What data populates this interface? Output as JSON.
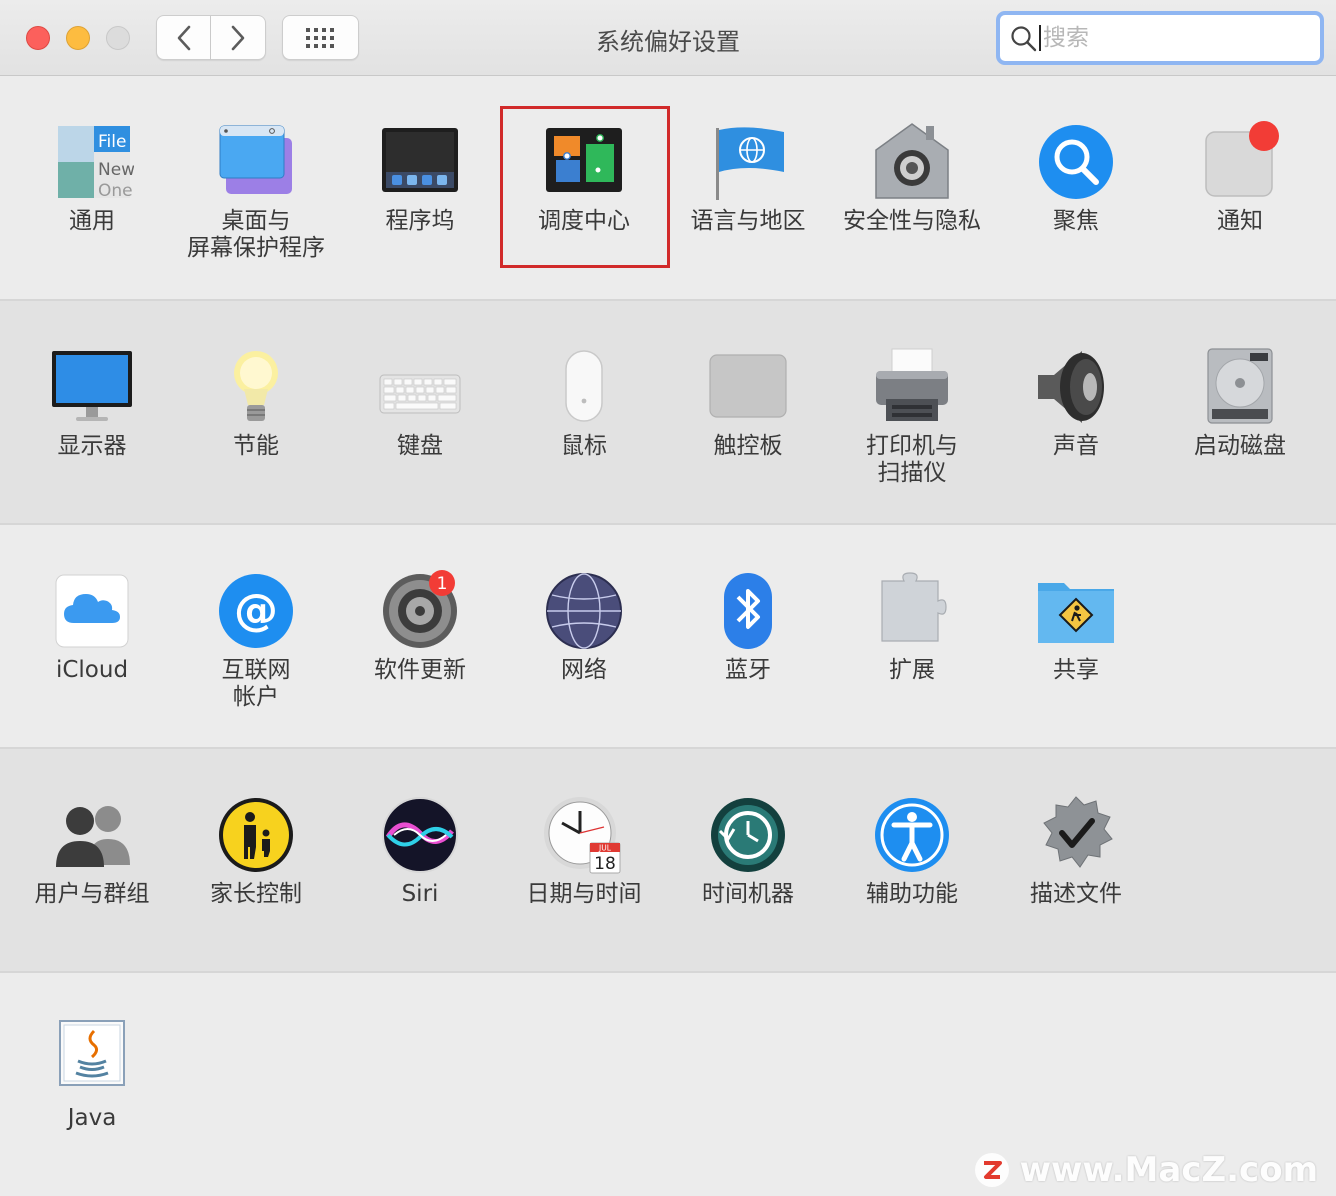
{
  "window": {
    "title": "系统偏好设置",
    "search_placeholder": "搜索"
  },
  "sections": [
    {
      "items": [
        {
          "label": "通用",
          "icon": "general-icon"
        },
        {
          "label": "桌面与",
          "label2": "屏幕保护程序",
          "icon": "desktop-screensaver-icon"
        },
        {
          "label": "程序坞",
          "icon": "dock-icon"
        },
        {
          "label": "调度中心",
          "icon": "mission-control-icon",
          "highlighted": true
        },
        {
          "label": "语言与地区",
          "icon": "language-region-icon"
        },
        {
          "label": "安全性与隐私",
          "icon": "security-privacy-icon"
        },
        {
          "label": "聚焦",
          "icon": "spotlight-icon"
        },
        {
          "label": "通知",
          "icon": "notifications-icon"
        }
      ]
    },
    {
      "items": [
        {
          "label": "显示器",
          "icon": "displays-icon"
        },
        {
          "label": "节能",
          "icon": "energy-saver-icon"
        },
        {
          "label": "键盘",
          "icon": "keyboard-icon"
        },
        {
          "label": "鼠标",
          "icon": "mouse-icon"
        },
        {
          "label": "触控板",
          "icon": "trackpad-icon"
        },
        {
          "label": "打印机与",
          "label2": "扫描仪",
          "icon": "printers-scanners-icon"
        },
        {
          "label": "声音",
          "icon": "sound-icon"
        },
        {
          "label": "启动磁盘",
          "icon": "startup-disk-icon"
        }
      ]
    },
    {
      "items": [
        {
          "label": "iCloud",
          "icon": "icloud-icon"
        },
        {
          "label": "互联网",
          "label2": "帐户",
          "icon": "internet-accounts-icon"
        },
        {
          "label": "软件更新",
          "icon": "software-update-icon",
          "badge": "1"
        },
        {
          "label": "网络",
          "icon": "network-icon"
        },
        {
          "label": "蓝牙",
          "icon": "bluetooth-icon"
        },
        {
          "label": "扩展",
          "icon": "extensions-icon"
        },
        {
          "label": "共享",
          "icon": "sharing-icon"
        }
      ]
    },
    {
      "items": [
        {
          "label": "用户与群组",
          "icon": "users-groups-icon"
        },
        {
          "label": "家长控制",
          "icon": "parental-controls-icon"
        },
        {
          "label": "Siri",
          "icon": "siri-icon"
        },
        {
          "label": "日期与时间",
          "icon": "date-time-icon",
          "cal_month": "JUL",
          "cal_day": "18"
        },
        {
          "label": "时间机器",
          "icon": "time-machine-icon"
        },
        {
          "label": "辅助功能",
          "icon": "accessibility-icon"
        },
        {
          "label": "描述文件",
          "icon": "profiles-icon"
        }
      ]
    },
    {
      "items": [
        {
          "label": "Java",
          "icon": "java-icon"
        }
      ]
    }
  ],
  "general_icon_text": [
    "File",
    "New",
    "One"
  ],
  "watermark": "www.MacZ.com",
  "colors": {
    "close": "#fc605c",
    "minimize": "#fdbc40",
    "zoom": "#dcdcdc",
    "highlight_border": "#d12a2a",
    "search_focus": "#8fb6f2",
    "badge": "#f23c36"
  }
}
